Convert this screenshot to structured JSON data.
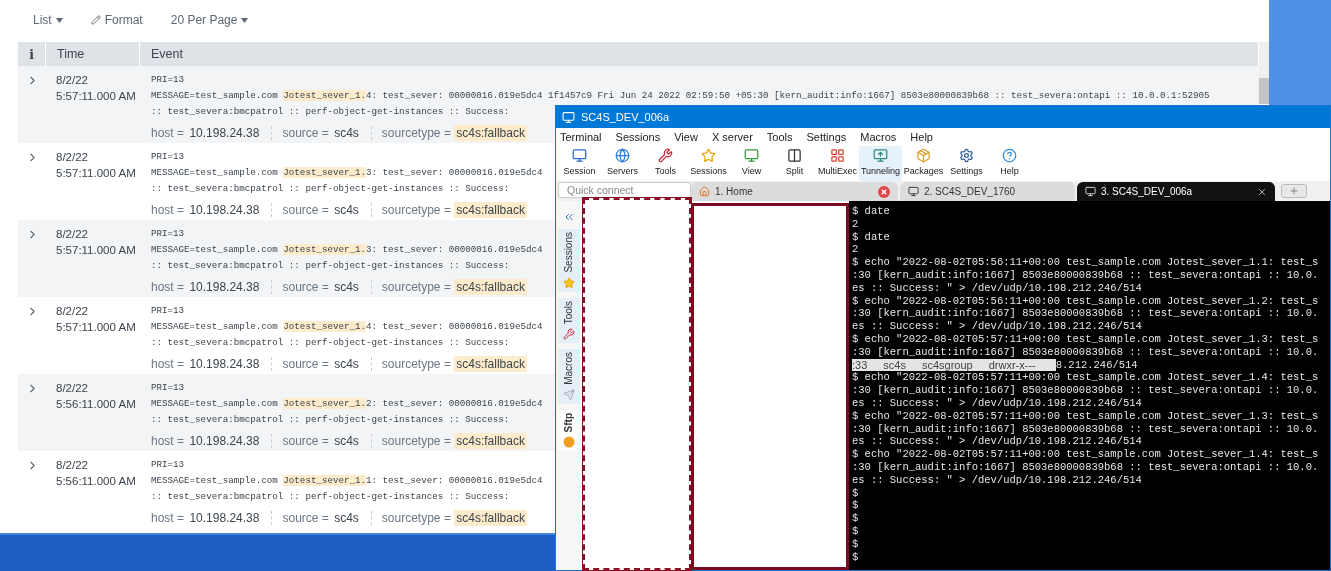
{
  "results_toolbar": {
    "view_menu": "List",
    "format_button": "Format",
    "page_size_menu": "20 Per Page"
  },
  "table": {
    "columns": [
      "i",
      "Time",
      "Event"
    ],
    "rows": [
      {
        "date": "8/2/22",
        "time": "5:57:11.000 AM",
        "pri": "PRI=13",
        "message": [
          {
            "text": "MESSAGE=test_sample.com ",
            "highlighted": false
          },
          {
            "text": "Jotest_sever_1.",
            "highlighted": true
          },
          {
            "text": "4: test_sever: 00000016.019e5dc4 1f1457c9 Fri Jun 24 2022 02:59:50 +05:30 [kern_audit:info:1667] 8503e80000839b68 :: test_severa:ontapi :: 10.0.0.1:52905",
            "highlighted": false
          }
        ],
        "message_2": ":: test_severa:bmcpatrol :: perf-object-get-instances :: Success:",
        "fields": [
          {
            "label": "host =",
            "value": "10.198.24.38",
            "highlighted": false
          },
          {
            "label": "source =",
            "value": "sc4s",
            "highlighted": false
          },
          {
            "label": "sourcetype =",
            "value": "sc4s:fallback",
            "highlighted": true
          }
        ]
      },
      {
        "date": "8/2/22",
        "time": "5:57:11.000 AM",
        "pri": "PRI=13",
        "message": [
          {
            "text": "MESSAGE=test_sample.com ",
            "highlighted": false
          },
          {
            "text": "Jotest_sever_1.",
            "highlighted": true
          },
          {
            "text": "3: test_sever: 00000016.019e5dc4",
            "highlighted": false
          }
        ],
        "message_2": ":: test_severa:bmcpatrol :: perf-object-get-instances :: Success:",
        "fields": [
          {
            "label": "host =",
            "value": "10.198.24.38",
            "highlighted": false
          },
          {
            "label": "source =",
            "value": "sc4s",
            "highlighted": false
          },
          {
            "label": "sourcetype =",
            "value": "sc4s:fallback",
            "highlighted": true
          }
        ]
      },
      {
        "date": "8/2/22",
        "time": "5:57:11.000 AM",
        "pri": "PRI=13",
        "message": [
          {
            "text": "MESSAGE=test_sample.com ",
            "highlighted": false
          },
          {
            "text": "Jotest_sever_1.",
            "highlighted": true
          },
          {
            "text": "3: test_sever: 00000016.019e5dc4",
            "highlighted": false
          }
        ],
        "message_2": ":: test_severa:bmcpatrol :: perf-object-get-instances :: Success:",
        "fields": [
          {
            "label": "host =",
            "value": "10.198.24.38",
            "highlighted": false
          },
          {
            "label": "source =",
            "value": "sc4s",
            "highlighted": false
          },
          {
            "label": "sourcetype =",
            "value": "sc4s:fallback",
            "highlighted": true
          }
        ]
      },
      {
        "date": "8/2/22",
        "time": "5:57:11.000 AM",
        "pri": "PRI=13",
        "message": [
          {
            "text": "MESSAGE=test_sample.com ",
            "highlighted": false
          },
          {
            "text": "Jotest_sever_1.",
            "highlighted": true
          },
          {
            "text": "4: test_sever: 00000016.019e5dc4",
            "highlighted": false
          }
        ],
        "message_2": ":: test_severa:bmcpatrol :: perf-object-get-instances :: Success:",
        "fields": [
          {
            "label": "host =",
            "value": "10.198.24.38",
            "highlighted": false
          },
          {
            "label": "source =",
            "value": "sc4s",
            "highlighted": false
          },
          {
            "label": "sourcetype =",
            "value": "sc4s:fallback",
            "highlighted": true
          }
        ]
      },
      {
        "date": "8/2/22",
        "time": "5:56:11.000 AM",
        "pri": "PRI=13",
        "message": [
          {
            "text": "MESSAGE=test_sample.com ",
            "highlighted": false
          },
          {
            "text": "Jotest_sever_1.",
            "highlighted": true
          },
          {
            "text": "2: test_sever: 00000016.019e5dc4",
            "highlighted": false
          }
        ],
        "message_2": ":: test_severa:bmcpatrol :: perf-object-get-instances :: Success:",
        "fields": [
          {
            "label": "host =",
            "value": "10.198.24.38",
            "highlighted": false
          },
          {
            "label": "source =",
            "value": "sc4s",
            "highlighted": false
          },
          {
            "label": "sourcetype =",
            "value": "sc4s:fallback",
            "highlighted": true
          }
        ]
      },
      {
        "date": "8/2/22",
        "time": "5:56:11.000 AM",
        "pri": "PRI=13",
        "message": [
          {
            "text": "MESSAGE=test_sample.com ",
            "highlighted": false
          },
          {
            "text": "Jotest_sever_1.",
            "highlighted": true
          },
          {
            "text": "1: test_sever: 00000016.019e5dc4",
            "highlighted": false
          }
        ],
        "message_2": ":: test_severa:bmcpatrol :: perf-object-get-instances :: Success:",
        "fields": [
          {
            "label": "host =",
            "value": "10.198.24.38",
            "highlighted": false
          },
          {
            "label": "source =",
            "value": "sc4s",
            "highlighted": false
          },
          {
            "label": "sourcetype =",
            "value": "sc4s:fallback",
            "highlighted": true
          }
        ]
      }
    ]
  },
  "terminal_window": {
    "title": "SC4S_DEV_006a",
    "menu": [
      "Terminal",
      "Sessions",
      "View",
      "X server",
      "Tools",
      "Settings",
      "Macros",
      "Help"
    ],
    "toolbar": [
      {
        "label": "Session",
        "hovered": false
      },
      {
        "label": "Servers",
        "hovered": false
      },
      {
        "label": "Tools",
        "hovered": false
      },
      {
        "label": "Sessions",
        "hovered": false
      },
      {
        "label": "View",
        "hovered": false
      },
      {
        "label": "Split",
        "hovered": false
      },
      {
        "label": "MultiExec",
        "hovered": false
      },
      {
        "label": "Tunneling",
        "hovered": true
      },
      {
        "label": "Packages",
        "hovered": false
      },
      {
        "label": "Settings",
        "hovered": false
      },
      {
        "label": "Help",
        "hovered": false
      }
    ],
    "quick_connect": {
      "placeholder": "Quick connect"
    },
    "tabs": [
      {
        "label": "1. Home",
        "selected": false,
        "closable": true
      },
      {
        "label": "2. SC4S_DEV_1760",
        "selected": false,
        "closable": false
      },
      {
        "label": "3. SC4S_DEV_006a",
        "selected": true,
        "closable": true
      }
    ],
    "side_tabs": [
      {
        "label": "Sessions",
        "selected": false
      },
      {
        "label": "Tools",
        "selected": false
      },
      {
        "label": "Macros",
        "selected": false
      },
      {
        "label": "Sftp",
        "selected": true
      }
    ],
    "terminal_lines": [
      {
        "kind": "text",
        "text": "$ date"
      },
      {
        "kind": "text",
        "text": "2"
      },
      {
        "kind": "text",
        "text": "$ date"
      },
      {
        "kind": "text",
        "text": "2"
      },
      {
        "kind": "text",
        "text": "$ echo \"2022-08-02T05:56:11+00:00 test_sample.com Jotest_sever_1.1: test_s"
      },
      {
        "kind": "text",
        "text": ":30 [kern_audit:info:1667] 8503e80000839b68 :: test_severa:ontapi :: 10.0."
      },
      {
        "kind": "text",
        "text": "es :: Success: \" > /dev/udp/10.198.212.246/514"
      },
      {
        "kind": "text",
        "text": "$ echo \"2022-08-02T05:56:11+00:00 test_sample.com Jotest_sever_1.2: test_s"
      },
      {
        "kind": "text",
        "text": ":30 [kern_audit:info:1667] 8503e80000839b68 :: test_severa:ontapi :: 10.0."
      },
      {
        "kind": "text",
        "text": "es :: Success: \" > /dev/udp/10.198.212.246/514"
      },
      {
        "kind": "text",
        "text": "$ echo \"2022-08-02T05:57:11+00:00 test_sample.com Jotest_sever_1.3: test_s"
      },
      {
        "kind": "text",
        "text": ":30 [kern_audit:info:1667] 8503e80000839b68 :: test_severa:ontapi :: 10.0."
      },
      {
        "kind": "listing",
        "cells": [
          ":33",
          "sc4s",
          "sc4sgroup",
          "drwxr-x---"
        ],
        "text": "8.212.246/514"
      },
      {
        "kind": "text",
        "text": "$ echo \"2022-08-02T05:57:11+00:00 test_sample.com Jotest_sever_1.4: test_s"
      },
      {
        "kind": "text",
        "text": ":30 [kern_audit:info:1667] 8503e80000839b68 :: test_severa:ontapi :: 10.0."
      },
      {
        "kind": "text",
        "text": "es :: Success: \" > /dev/udp/10.198.212.246/514"
      },
      {
        "kind": "text",
        "text": "$ echo \"2022-08-02T05:57:11+00:00 test_sample.com Jotest_sever_1.3: test_s"
      },
      {
        "kind": "text",
        "text": ":30 [kern_audit:info:1667] 8503e80000839b68 :: test_severa:ontapi :: 10.0."
      },
      {
        "kind": "text",
        "text": "es :: Success: \" > /dev/udp/10.198.212.246/514"
      },
      {
        "kind": "text",
        "text": "$ echo \"2022-08-02T05:57:11+00:00 test_sample.com Jotest_sever_1.4: test_s"
      },
      {
        "kind": "text",
        "text": ":30 [kern_audit:info:1667] 8503e80000839b68 :: test_severa:ontapi :: 10.0."
      },
      {
        "kind": "text",
        "text": "es :: Success: \" > /dev/udp/10.198.212.246/514"
      },
      {
        "kind": "text",
        "text": "$"
      },
      {
        "kind": "text",
        "text": "$"
      },
      {
        "kind": "text",
        "text": "$"
      },
      {
        "kind": "text",
        "text": "$"
      },
      {
        "kind": "text",
        "text": "$"
      },
      {
        "kind": "text",
        "text": "$"
      }
    ]
  }
}
